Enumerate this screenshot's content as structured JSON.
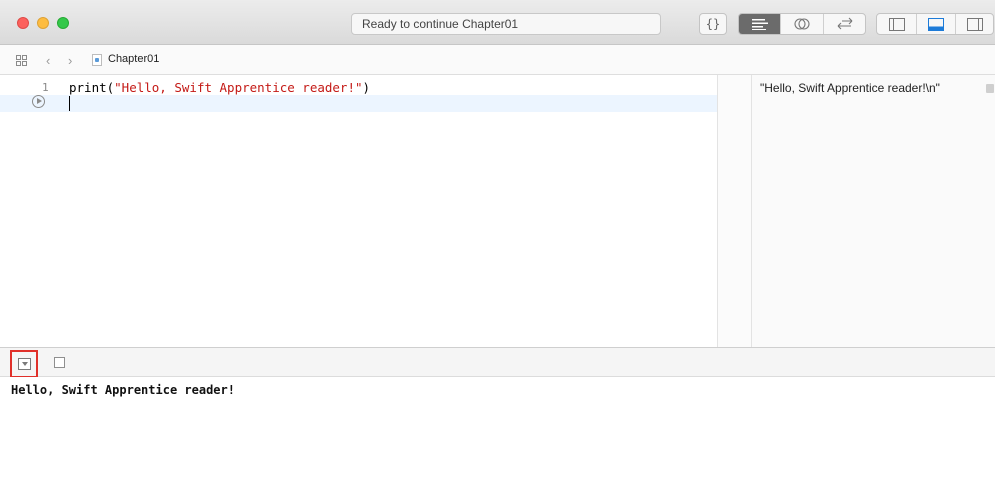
{
  "window": {
    "status": "Ready to continue Chapter01"
  },
  "toolbar": {
    "braces_label": "{}",
    "icons": [
      "standard-editor-icon",
      "assistant-editor-icon",
      "version-editor-icon",
      "navigator-icon",
      "debug-area-icon",
      "utilities-icon"
    ]
  },
  "jumpbar": {
    "file_label": "Chapter01"
  },
  "editor": {
    "line_number": "1",
    "code_prefix": "print(",
    "code_string": "\"Hello, Swift Apprentice reader!\"",
    "code_suffix": ")"
  },
  "results": {
    "value": "\"Hello, Swift Apprentice reader!\\n\""
  },
  "console": {
    "output": "Hello, Swift Apprentice reader!"
  },
  "colors": {
    "highlight_border": "#e0302a",
    "string_literal": "#c41a16",
    "current_line": "#ecf5ff"
  }
}
